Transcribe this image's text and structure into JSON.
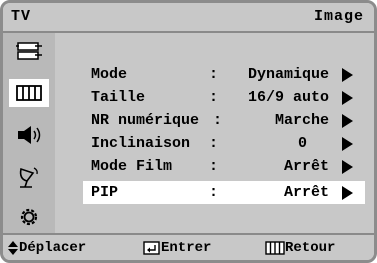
{
  "title": {
    "left": "TV",
    "right": "Image"
  },
  "menu": [
    {
      "label": "Mode",
      "value": "Dynamique"
    },
    {
      "label": "Taille",
      "value": "16/9 auto"
    },
    {
      "label": "NR numérique",
      "value": "Marche"
    },
    {
      "label": "Inclinaison",
      "value": "0"
    },
    {
      "label": "Mode Film",
      "value": "Arrêt"
    },
    {
      "label": "PIP",
      "value": "Arrêt"
    }
  ],
  "menu_separator": ":",
  "selected_index": 5,
  "sidebar_icons": [
    "input-icon",
    "picture-icon",
    "sound-icon",
    "channel-icon",
    "setup-icon"
  ],
  "active_sidebar_index": 1,
  "footer": {
    "move": "Déplacer",
    "enter": "Entrer",
    "return": "Retour"
  }
}
